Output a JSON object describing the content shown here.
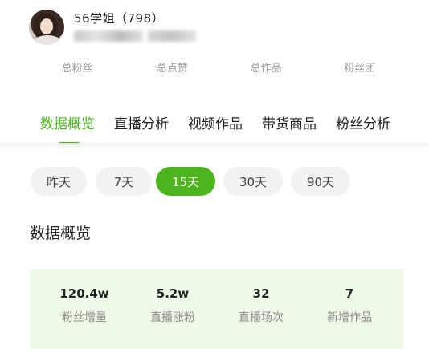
{
  "profile": {
    "name": "56学姐（798）"
  },
  "stats": {
    "labels": [
      "总粉丝",
      "总点赞",
      "总作品",
      "粉丝团"
    ]
  },
  "tabs": [
    {
      "label": "数据概览",
      "active": true
    },
    {
      "label": "直播分析",
      "active": false
    },
    {
      "label": "视频作品",
      "active": false
    },
    {
      "label": "带货商品",
      "active": false
    },
    {
      "label": "粉丝分析",
      "active": false
    }
  ],
  "ranges": [
    {
      "label": "昨天",
      "active": false
    },
    {
      "label": "7天",
      "active": false
    },
    {
      "label": "15天",
      "active": true
    },
    {
      "label": "30天",
      "active": false
    },
    {
      "label": "90天",
      "active": false
    }
  ],
  "section": {
    "title": "数据概览"
  },
  "overview": [
    {
      "value": "120.4w",
      "label": "粉丝增量"
    },
    {
      "value": "5.2w",
      "label": "直播涨粉"
    },
    {
      "value": "32",
      "label": "直播场次"
    },
    {
      "value": "7",
      "label": "新增作品"
    }
  ],
  "colors": {
    "accent": "#4cb51e",
    "overview_bg": "#eef9e7",
    "pill_bg": "#f2f2f2"
  }
}
